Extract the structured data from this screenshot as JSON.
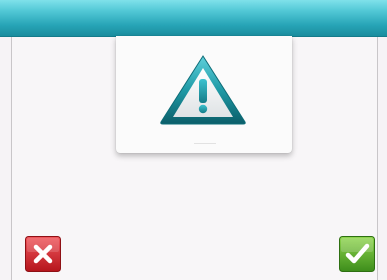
{
  "theme": {
    "header_color": "#2aa7b8",
    "warning_color": "#1f9aa6",
    "cancel_color": "#d9282f",
    "confirm_color": "#5aaa2a"
  },
  "dialog": {
    "icon": "warning-triangle-icon"
  },
  "actions": {
    "cancel_icon": "close-x-icon",
    "confirm_icon": "checkmark-icon"
  }
}
